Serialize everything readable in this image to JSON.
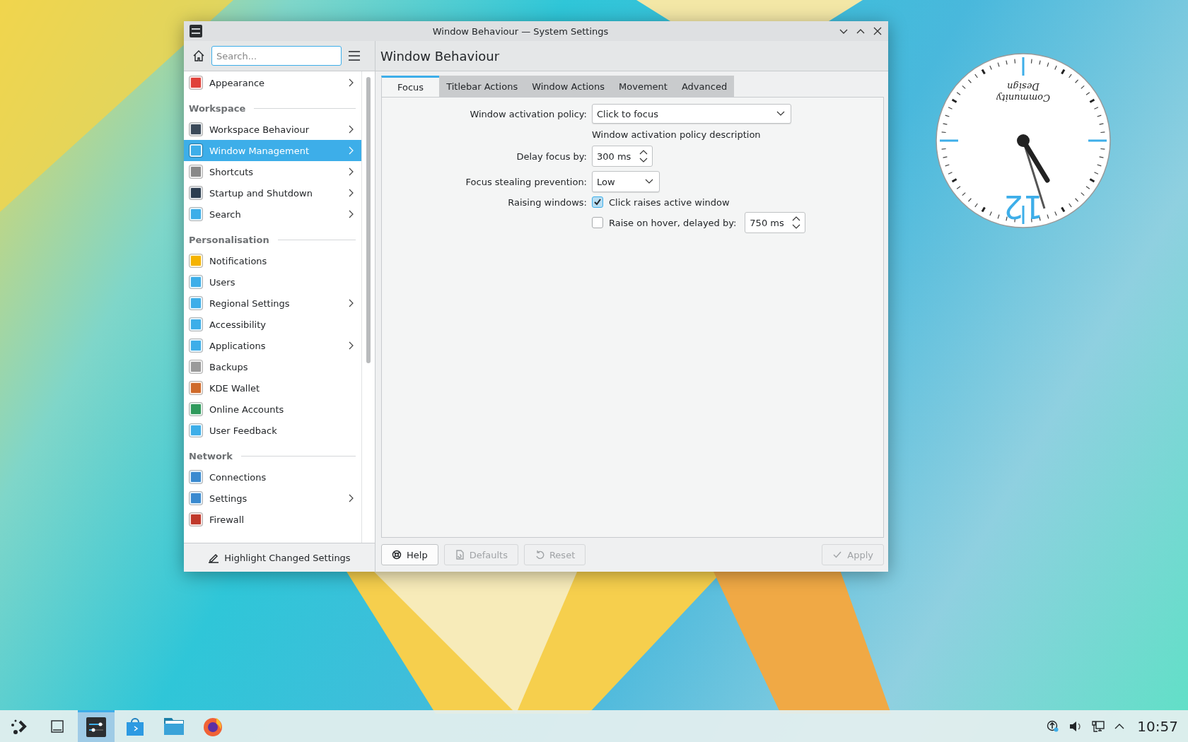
{
  "window": {
    "title": "Window Behaviour — System Settings"
  },
  "sidebar": {
    "search": {
      "placeholder": "Search..."
    },
    "items": [
      {
        "kind": "item",
        "label": "Appearance",
        "expandable": true,
        "selected": false
      },
      {
        "kind": "header",
        "label": "Workspace"
      },
      {
        "kind": "item",
        "label": "Workspace Behaviour",
        "expandable": true,
        "selected": false
      },
      {
        "kind": "item",
        "label": "Window Management",
        "expandable": true,
        "selected": true
      },
      {
        "kind": "item",
        "label": "Shortcuts",
        "expandable": true,
        "selected": false
      },
      {
        "kind": "item",
        "label": "Startup and Shutdown",
        "expandable": true,
        "selected": false
      },
      {
        "kind": "item",
        "label": "Search",
        "expandable": true,
        "selected": false
      },
      {
        "kind": "header",
        "label": "Personalisation"
      },
      {
        "kind": "item",
        "label": "Notifications",
        "expandable": false,
        "selected": false
      },
      {
        "kind": "item",
        "label": "Users",
        "expandable": false,
        "selected": false
      },
      {
        "kind": "item",
        "label": "Regional Settings",
        "expandable": true,
        "selected": false
      },
      {
        "kind": "item",
        "label": "Accessibility",
        "expandable": false,
        "selected": false
      },
      {
        "kind": "item",
        "label": "Applications",
        "expandable": true,
        "selected": false
      },
      {
        "kind": "item",
        "label": "Backups",
        "expandable": false,
        "selected": false
      },
      {
        "kind": "item",
        "label": "KDE Wallet",
        "expandable": false,
        "selected": false
      },
      {
        "kind": "item",
        "label": "Online Accounts",
        "expandable": false,
        "selected": false
      },
      {
        "kind": "item",
        "label": "User Feedback",
        "expandable": false,
        "selected": false
      },
      {
        "kind": "header",
        "label": "Network"
      },
      {
        "kind": "item",
        "label": "Connections",
        "expandable": false,
        "selected": false
      },
      {
        "kind": "item",
        "label": "Settings",
        "expandable": true,
        "selected": false
      },
      {
        "kind": "item",
        "label": "Firewall",
        "expandable": false,
        "selected": false
      }
    ],
    "footer_button": "Highlight Changed Settings"
  },
  "page": {
    "title": "Window Behaviour",
    "tabs": [
      {
        "label": "Focus",
        "selected": true
      },
      {
        "label": "Titlebar Actions",
        "selected": false
      },
      {
        "label": "Window Actions",
        "selected": false
      },
      {
        "label": "Movement",
        "selected": false
      },
      {
        "label": "Advanced",
        "selected": false
      }
    ],
    "form": [
      {
        "kind": "combo",
        "label": "Window activation policy:",
        "value": "Click to focus"
      },
      {
        "kind": "note",
        "text": "Window activation policy description"
      },
      {
        "kind": "spin",
        "label": "Delay focus by:",
        "value": "300 ms"
      },
      {
        "kind": "combo",
        "label": "Focus stealing prevention:",
        "value": "Low"
      },
      {
        "kind": "check",
        "label": "Raising windows:",
        "text": "Click raises active window",
        "checked": true
      },
      {
        "kind": "check",
        "text": "Raise on hover, delayed by:",
        "checked": false,
        "value": "750 ms"
      }
    ]
  },
  "buttons": [
    {
      "kind": "help",
      "label": "Help",
      "disabled": false
    },
    {
      "kind": "defaults",
      "label": "Defaults",
      "disabled": true
    },
    {
      "kind": "reset",
      "label": "Reset",
      "disabled": true
    },
    {
      "kind": "apply",
      "label": "Apply",
      "disabled": true
    }
  ],
  "clock": {
    "brand": [
      "Community",
      "Design"
    ],
    "numeral": "12"
  },
  "taskbar": {
    "tasks": [
      {
        "selected": false
      },
      {
        "selected": false
      },
      {
        "selected": true
      },
      {
        "selected": false
      },
      {
        "selected": false
      },
      {
        "selected": false
      }
    ],
    "time": "10:57"
  }
}
